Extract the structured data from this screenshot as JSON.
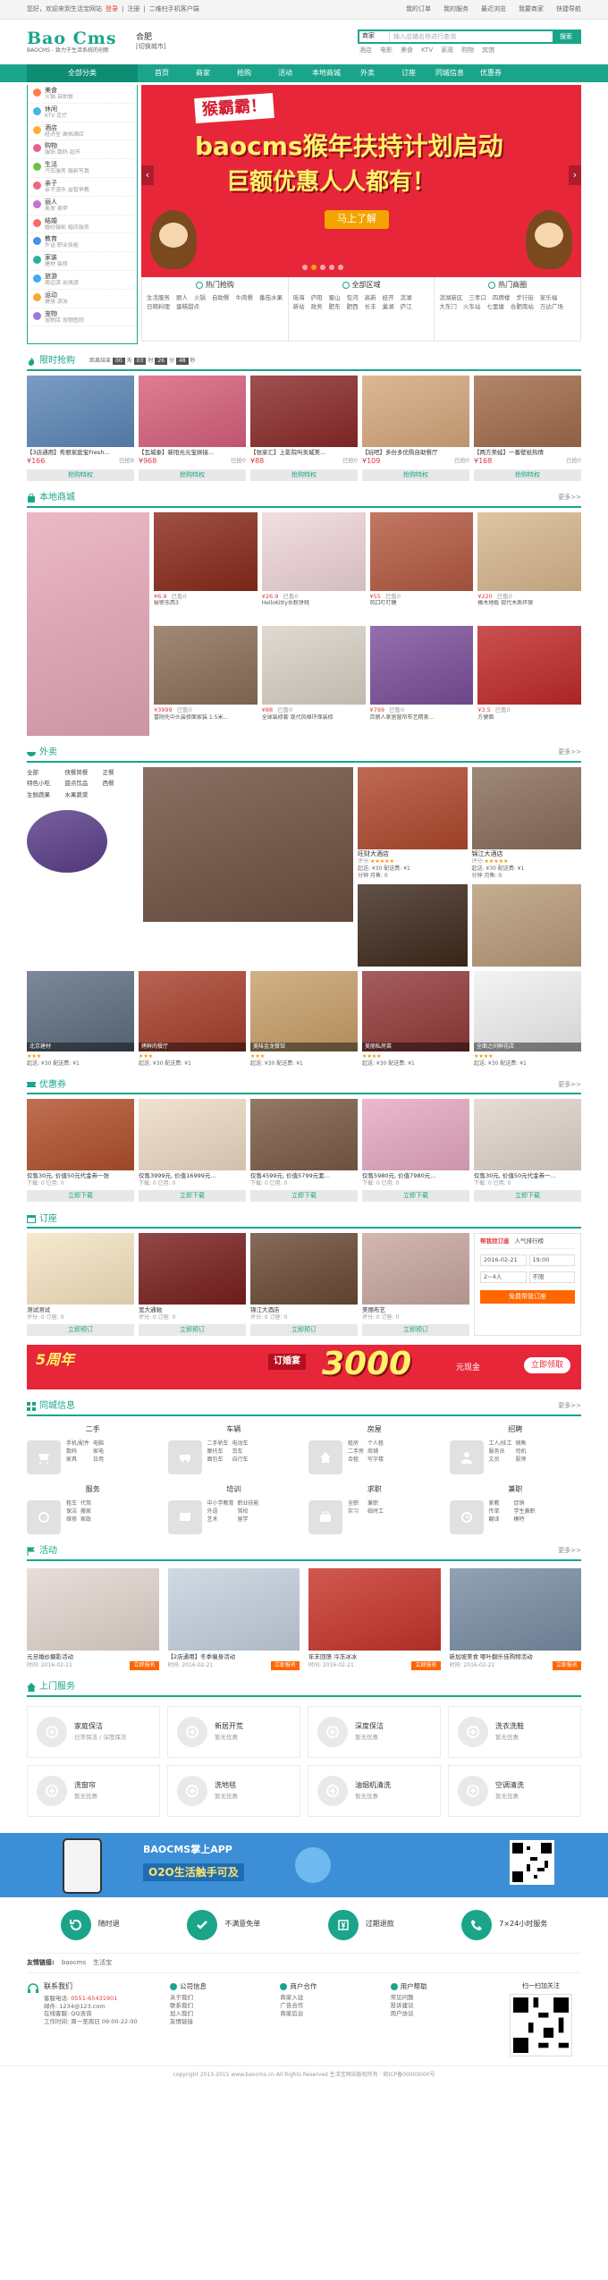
{
  "topbar": {
    "welcome": "您好，欢迎来到生活宝网站",
    "login": "登录",
    "register": "注册",
    "mobile": "二维扫手机客户端",
    "links": [
      "我的订单",
      "我的服务",
      "最近浏览",
      "我要商家",
      "快捷导航"
    ]
  },
  "header": {
    "logo_title": "Bao Cms",
    "logo_slogan": "BAOCMS - 致力于生活系统的创新",
    "city": "合肥",
    "city_switch": "[切换城市]",
    "search_select": "商家",
    "search_placeholder": "输入店铺名称进行查询",
    "search_button": "搜索",
    "hot_words": [
      "酒店",
      "电影",
      "美食",
      "KTV",
      "家政",
      "购物",
      "宾馆"
    ]
  },
  "nav": {
    "all": "全部分类",
    "items": [
      "首页",
      "商家",
      "抢购",
      "活动",
      "本地商城",
      "外卖",
      "订座",
      "同城信息",
      "优惠券"
    ]
  },
  "categories": [
    {
      "name": "美食",
      "sub": "火锅 自助餐",
      "color": "#ff7e4f"
    },
    {
      "name": "休闲",
      "sub": "KTV 足疗",
      "color": "#45b6e6"
    },
    {
      "name": "酒店",
      "sub": "经济型 高档酒店",
      "color": "#ffae3b"
    },
    {
      "name": "购物",
      "sub": "服饰 数码 超市",
      "color": "#e95d8f"
    },
    {
      "name": "生活",
      "sub": "汽车服务 摄影写真",
      "color": "#74bf42"
    },
    {
      "name": "亲子",
      "sub": "亲子游乐 益智早教",
      "color": "#f2637a"
    },
    {
      "name": "丽人",
      "sub": "美发 美甲",
      "color": "#c471d6"
    },
    {
      "name": "结婚",
      "sub": "婚纱摄影 婚庆服务",
      "color": "#ff6a6a"
    },
    {
      "name": "教育",
      "sub": "外语 职业技能",
      "color": "#4a8ee8"
    },
    {
      "name": "家装",
      "sub": "建材 装修",
      "color": "#2bb0a0"
    },
    {
      "name": "旅游",
      "sub": "周边游 出境游",
      "color": "#3fa9f5"
    },
    {
      "name": "运动",
      "sub": "健身 游泳",
      "color": "#f7a733"
    },
    {
      "name": "宠物",
      "sub": "宠物店 宠物医院",
      "color": "#9b7bd8"
    }
  ],
  "banner": {
    "tag": "猴霸霸！",
    "line1": "baocms猴年扶持计划启动",
    "line2": "巨额优惠人人都有！",
    "button": "马上了解"
  },
  "hero_links": [
    {
      "title": "热门抢购",
      "links": [
        "生活服务",
        "丽人",
        "火锅",
        "自助餐",
        "牛肉餐",
        "番茄水果",
        "日韩料理",
        "蛋糕甜点"
      ]
    },
    {
      "title": "全部区域",
      "links": [
        "瑶海",
        "庐阳",
        "蜀山",
        "包河",
        "高新",
        "经开",
        "滨湖",
        "新站",
        "政务",
        "肥东",
        "肥西",
        "长丰",
        "巢湖",
        "庐江"
      ]
    },
    {
      "title": "热门商圈",
      "links": [
        "滨湖新区",
        "三孝口",
        "四牌楼",
        "步行街",
        "家乐福",
        "大东门",
        "火车站",
        "七里塘",
        "合肥南站",
        "万达广场"
      ]
    }
  ],
  "flash_sale": {
    "title": "限时抢购",
    "countdown_label": "距离结束",
    "countdown": [
      "00",
      "天",
      "03",
      "时",
      "26",
      "分",
      "48",
      "秒"
    ],
    "items": [
      {
        "name": "【3店通用】秀丽家庭宝Fresh...",
        "price": "¥166",
        "sold": "已抢8",
        "color": "#5d87b8"
      },
      {
        "name": "【瓦城泰】新阳光元宝拼接...",
        "price": "¥968",
        "sold": "已抢0",
        "color": "#d8617d"
      },
      {
        "name": "【张家汇】上影院叫卖城美...",
        "price": "¥88",
        "sold": "已抢0",
        "color": "#8b2a2a"
      },
      {
        "name": "【玩吧】多份多优购自助餐厅",
        "price": "¥109",
        "sold": "已抢0",
        "color": "#d6a87e"
      },
      {
        "name": "【两方美蛙】一番壁纸热情",
        "price": "¥168",
        "sold": "已抢0",
        "color": "#a26c4b"
      }
    ],
    "buy_label": "抢购特权"
  },
  "mall": {
    "title": "本地商城",
    "more": "更多>>",
    "big_color": "#e7a9b8",
    "items": [
      {
        "price": "¥6.9",
        "sold": "已售0",
        "name": "秘密东西3",
        "color": "#8a2a1b"
      },
      {
        "price": "¥26.9",
        "sold": "已售0",
        "name": "HelloKitty水粉饼桃",
        "color": "#f0d6db"
      },
      {
        "price": "¥55",
        "sold": "已售0",
        "name": "风口叮叮糖",
        "color": "#b55a42"
      },
      {
        "price": "¥220",
        "sold": "已售0",
        "name": "橡木地板 现代木质环保",
        "color": "#d9b88f"
      },
      {
        "price": "¥3999",
        "sold": "已售0",
        "name": "富刚先中头装修面家装 1.5米...",
        "color": "#8c6f5a"
      },
      {
        "price": "¥88",
        "sold": "已售0",
        "name": "全球装修套 现代风格环保装修",
        "color": "#d9d2c7"
      },
      {
        "price": "¥799",
        "sold": "已售0",
        "name": "百丽人家居窗帘布艺精美...",
        "color": "#7d4f9b"
      },
      {
        "price": "¥3.5",
        "sold": "已售0",
        "name": "方便面",
        "color": "#c12a2a"
      }
    ]
  },
  "waimai": {
    "title": "外卖",
    "more": "更多>>",
    "cats": [
      "全部",
      "快餐简餐",
      "正餐",
      "特色小吃",
      "甜点饮品",
      "西餐",
      "生鲜蔬果",
      "水果蔬菜"
    ],
    "big_color": "#6f5141",
    "shops": [
      {
        "name": "旺财大酒店",
        "rating": "评分:",
        "stars": "★★★★★",
        "delivery": "起送: ¥30  配送费: ¥1",
        "time": "分钟",
        "sold": "月售: 0",
        "color": "#b1492e"
      },
      {
        "name": "锦江大酒店",
        "rating": "评分:",
        "stars": "★★★★★",
        "delivery": "起送: ¥30  配送费: ¥1",
        "time": "分钟",
        "sold": "月售: 0",
        "color": "#8a6e5b"
      },
      {
        "name": "",
        "rating": "",
        "stars": "",
        "delivery": "",
        "time": "",
        "sold": "",
        "color": "#3f2a1d"
      },
      {
        "name": "",
        "rating": "",
        "stars": "",
        "delivery": "",
        "time": "",
        "sold": "",
        "color": "#b99b7a"
      }
    ],
    "row2": [
      {
        "cap": "北京建材",
        "stars": "★★★",
        "delivery": "起送: ¥30  配送费: ¥1",
        "color": "#5e6f82"
      },
      {
        "cap": "烤鲜肉餐厅",
        "stars": "★★★",
        "delivery": "起送: ¥30  配送费: ¥1",
        "color": "#a8402d"
      },
      {
        "cap": "美味金龙餐馆",
        "stars": "★★★",
        "delivery": "起送: ¥30  配送费: ¥1",
        "color": "#c8a06a"
      },
      {
        "cap": "美丽私房菜",
        "stars": "★★★★",
        "delivery": "起送: ¥30  配送费: ¥1",
        "color": "#933a3a"
      },
      {
        "cap": "全面之间鲜花店",
        "stars": "★★★★",
        "delivery": "起送: ¥30  配送费: ¥1",
        "color": "#f1f1f1"
      }
    ]
  },
  "coupons": {
    "title": "优惠券",
    "more": "更多>>",
    "items": [
      {
        "name": "仅售30元, 价值50元代金券一张",
        "meta": "下载: 0  已用: 0",
        "color": "#b2502c"
      },
      {
        "name": "仅售3999元, 价值16999元...",
        "meta": "下载: 0  已用: 0",
        "color": "#eddcc5"
      },
      {
        "name": "仅售4599元, 价值5799元套...",
        "meta": "下载: 0  已用: 0",
        "color": "#7c5b45"
      },
      {
        "name": "仅售5980元, 价值7980元...",
        "meta": "下载: 0  已用: 0",
        "color": "#e7a9c3"
      },
      {
        "name": "仅售30元, 价值50元代金券一...",
        "meta": "下载: 0  已用: 0",
        "color": "#e1d5cc"
      }
    ],
    "btn": "立即下载"
  },
  "booking": {
    "title": "订座",
    "items": [
      {
        "name": "测试测试",
        "meta": "评分: 0  订座: 0",
        "color": "#f6e5c3"
      },
      {
        "name": "宽大通驰",
        "meta": "评分: 0  订座: 0",
        "color": "#7a1f1f"
      },
      {
        "name": "锦江大酒店",
        "meta": "评分: 0  订座: 0",
        "color": "#6b4a36"
      },
      {
        "name": "美丽布艺",
        "meta": "评分: 0  订座: 0",
        "color": "#c9a7a0"
      }
    ],
    "btn": "立即预订",
    "form": {
      "tab1": "帮我找订座",
      "tab2": "人气排行榜",
      "date": "2016-02-21",
      "time": "19:00",
      "people": "2~4人",
      "area": "不限",
      "button": "免费帮我订座"
    }
  },
  "adbar": {
    "tag": "5周年",
    "mid": "订婚宴",
    "big": "3000",
    "unit": "元现金",
    "btn": "立即领取"
  },
  "classified": {
    "title": "同城信息",
    "more": "更多>>",
    "groups": [
      {
        "title": "二手",
        "links": [
          "手机/配件",
          "电脑",
          "数码",
          "家电",
          "家具",
          "日用"
        ]
      },
      {
        "title": "车辆",
        "links": [
          "二手轿车",
          "电动车",
          "摩托车",
          "货车",
          "面包车",
          "自行车"
        ]
      },
      {
        "title": "房屋",
        "links": [
          "租房",
          "个人租",
          "二手房",
          "商铺",
          "合租",
          "写字楼"
        ]
      },
      {
        "title": "招聘",
        "links": [
          "工人/技工",
          "销售",
          "服务员",
          "司机",
          "文员",
          "厨师"
        ]
      },
      {
        "title": "服务",
        "links": [
          "租车",
          "代驾",
          "保洁",
          "搬家",
          "维修",
          "家政"
        ]
      },
      {
        "title": "培训",
        "links": [
          "中小学教育",
          "职业技能",
          "外语",
          "驾校",
          "艺术",
          "留学"
        ]
      },
      {
        "title": "求职",
        "links": [
          "全职",
          "兼职",
          "实习",
          "临时工"
        ]
      },
      {
        "title": "兼职",
        "links": [
          "家教",
          "促销",
          "传单",
          "学生兼职",
          "翻译",
          "模特"
        ]
      }
    ]
  },
  "activities": {
    "title": "活动",
    "more": "更多>>",
    "items": [
      {
        "name": "元旦婚纱摄影活动",
        "date": "时间: 2016-02-21",
        "color": "#e3d6cf"
      },
      {
        "name": "【2店通用】冬季瘦身活动",
        "date": "时间: 2016-02-21",
        "color": "#c5d2df"
      },
      {
        "name": "年末回馈 冷冻冰冰",
        "date": "时间: 2016-02-21",
        "color": "#c7342a"
      },
      {
        "name": "新加坡美食 哪叶翻乐佳购物活动",
        "date": "时间: 2016-02-21",
        "color": "#7a8ea5"
      }
    ],
    "btn": "立即报名"
  },
  "services": {
    "title": "上门服务",
    "items": [
      {
        "name": "家庭保洁",
        "sub": "日常保洁 / 深度保洁"
      },
      {
        "name": "新居开荒",
        "sub": "暂无优惠"
      },
      {
        "name": "深度保洁",
        "sub": "暂无优惠"
      },
      {
        "name": "洗衣洗鞋",
        "sub": "暂无优惠"
      },
      {
        "name": "洗窗帘",
        "sub": "暂无优惠"
      },
      {
        "name": "洗地毯",
        "sub": "暂无优惠"
      },
      {
        "name": "油烟机清洗",
        "sub": "暂无优惠"
      },
      {
        "name": "空调清洗",
        "sub": "暂无优惠"
      }
    ]
  },
  "appbar": {
    "title": "BAOCMS掌上APP",
    "sub": "O2O生活触手可及"
  },
  "guarantees": [
    "随时退",
    "不满意免单",
    "过期退款",
    "7×24小时服务"
  ],
  "friend_links": {
    "label": "友情链接:",
    "items": [
      "baocms",
      "生活宝"
    ]
  },
  "footer": {
    "contact_title": "联系我们",
    "hotline_label": "客服电话:",
    "hotline": "0551-65431901",
    "email": "邮件: 1234@123.com",
    "qq": "在线客服: QQ咨询",
    "hours": "工作时间: 周一至周日 09:00-22:00",
    "cols": [
      {
        "title": "公司信息",
        "links": [
          "关于我们",
          "联系我们",
          "加入我们",
          "友情链接"
        ]
      },
      {
        "title": "商户合作",
        "links": [
          "商家入驻",
          "广告合作",
          "商家后台"
        ]
      },
      {
        "title": "用户帮助",
        "links": [
          "常见问题",
          "投诉建议",
          "用户协议"
        ]
      }
    ],
    "qr_title": "扫一扫加关注",
    "copyright": "copyright 2013-2015 www.baocms.cn All Rights Reserved 生活宝网站版权所有 · 皖ICP备00000000号"
  }
}
